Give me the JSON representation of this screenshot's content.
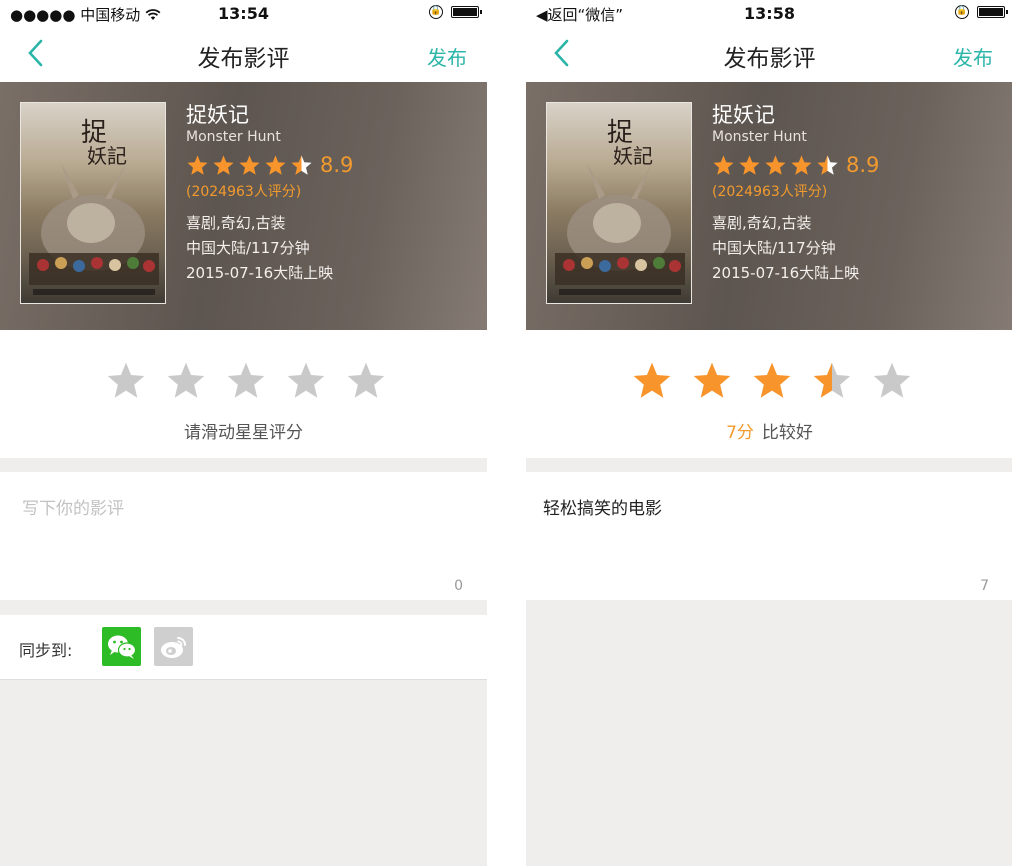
{
  "colors": {
    "accent": "#2bb5a8",
    "star_active": "#f7952c",
    "star_inactive": "#c9c9c9",
    "wechat": "#2dbb26",
    "weibo": "#cfcfcf"
  },
  "icons": {
    "back": "chevron-left-icon",
    "wifi": "wifi-icon",
    "lock": "rotation-lock-icon",
    "battery": "battery-icon",
    "wechat": "wechat-icon",
    "weibo": "weibo-icon",
    "star": "star-icon"
  },
  "left": {
    "status": {
      "left": "●●●●● 中国移动 ",
      "time": "13:54"
    },
    "nav": {
      "title": "发布影评",
      "publish": "发布"
    },
    "movie": {
      "title": "捉妖记",
      "subtitle": "Monster Hunt",
      "rating": 4.5,
      "score": "8.9",
      "count": "(2024963人评分)",
      "genre": "喜剧,奇幻,古装",
      "region": "中国大陆/117分钟",
      "release": "2015-07-16大陆上映"
    },
    "user_rating": 0,
    "rate_hint": "请滑动星星评分",
    "review": {
      "placeholder": "写下你的影评",
      "count": "0"
    },
    "sync_label": "同步到:"
  },
  "right": {
    "status": {
      "left": "◀返回“微信”",
      "time": "13:58"
    },
    "nav": {
      "title": "发布影评",
      "publish": "发布"
    },
    "movie": {
      "title": "捉妖记",
      "subtitle": "Monster Hunt",
      "rating": 4.5,
      "score": "8.9",
      "count": "(2024963人评分)",
      "genre": "喜剧,奇幻,古装",
      "region": "中国大陆/117分钟",
      "release": "2015-07-16大陆上映"
    },
    "user_rating": 3.5,
    "rate_score": "7分",
    "rate_desc": "比较好",
    "review": {
      "text": "轻松搞笑的电影",
      "count": "7"
    }
  }
}
